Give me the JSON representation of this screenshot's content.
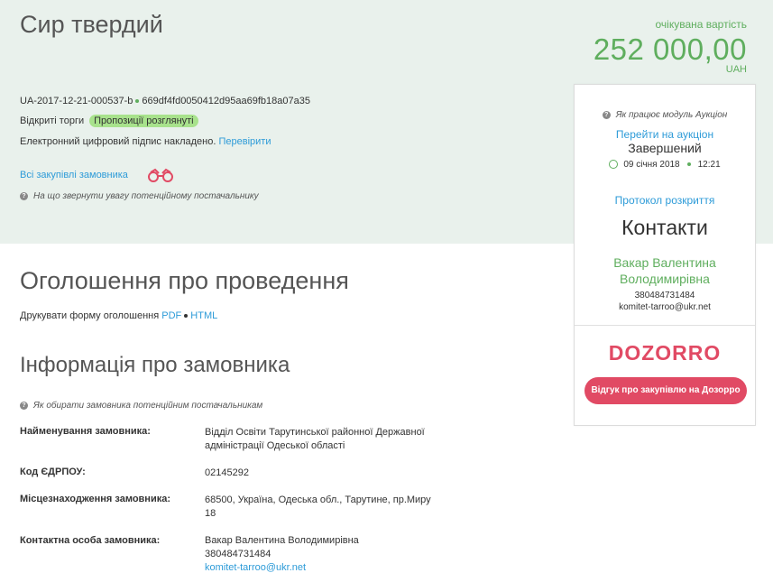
{
  "header": {
    "title": "Сир твердий",
    "expected_label": "очікувана вартість",
    "amount": "252 000,00",
    "currency": "UAH",
    "tender_id": "UA-2017-12-21-000537-b",
    "hash": "669df4fd0050412d95aa69fb18a07a35",
    "procedure_type": "Відкриті торги",
    "status_badge": "Пропозиції розглянуті",
    "signature_text": "Електронний цифровий підпис накладено.",
    "verify_link": "Перевірити",
    "all_purchases_link": "Всі закупівлі замовника",
    "supplier_note": "На що звернути увагу потенційному постачальнику"
  },
  "sidebar": {
    "auction_help": "Як працює модуль Аукціон",
    "goto_auction": "Перейти на аукціон",
    "auction_status": "Завершений",
    "auction_date": "09 січня 2018",
    "auction_time": "12:21",
    "protocol_link": "Протокол розкриття",
    "contacts_title": "Контакти",
    "contact_name_line1": "Вакар Валентина",
    "contact_name_line2": "Володимирівна",
    "contact_phone": "380484731484",
    "contact_email": "komitet-tarroo@ukr.net",
    "dozorro_logo": "DOZORRO",
    "dozorro_button": "Відгук про закупівлю на Дозорро"
  },
  "announcement": {
    "title": "Оголошення про проведення",
    "print_text": "Друкувати форму оголошення",
    "pdf": "PDF",
    "html": "HTML"
  },
  "customer": {
    "title": "Інформація про замовника",
    "note": "Як обирати замовника потенційним постачальникам",
    "rows": [
      {
        "label": "Найменування замовника:",
        "value_line1": "Відділ Освіти Тарутинської районної Державної",
        "value_line2": "адміністрації Одеської області"
      },
      {
        "label": "Код ЄДРПОУ:",
        "value_line1": "02145292"
      },
      {
        "label": "Місцезнаходження замовника:",
        "value_line1": "68500, Україна, Одеська обл., Тарутине, пр.Миру",
        "value_line2": "18"
      },
      {
        "label": "Контактна особа замовника:",
        "value_line1": "Вакар Валентина Володимирівна",
        "value_line2": "380484731484",
        "value_line3": "komitet-tarroo@ukr.net"
      }
    ]
  },
  "colors": {
    "accent_green": "#5fae5e",
    "link_blue": "#2d9bd8",
    "header_bg": "#e9f1ec",
    "dozorro_red": "#e14a64"
  }
}
